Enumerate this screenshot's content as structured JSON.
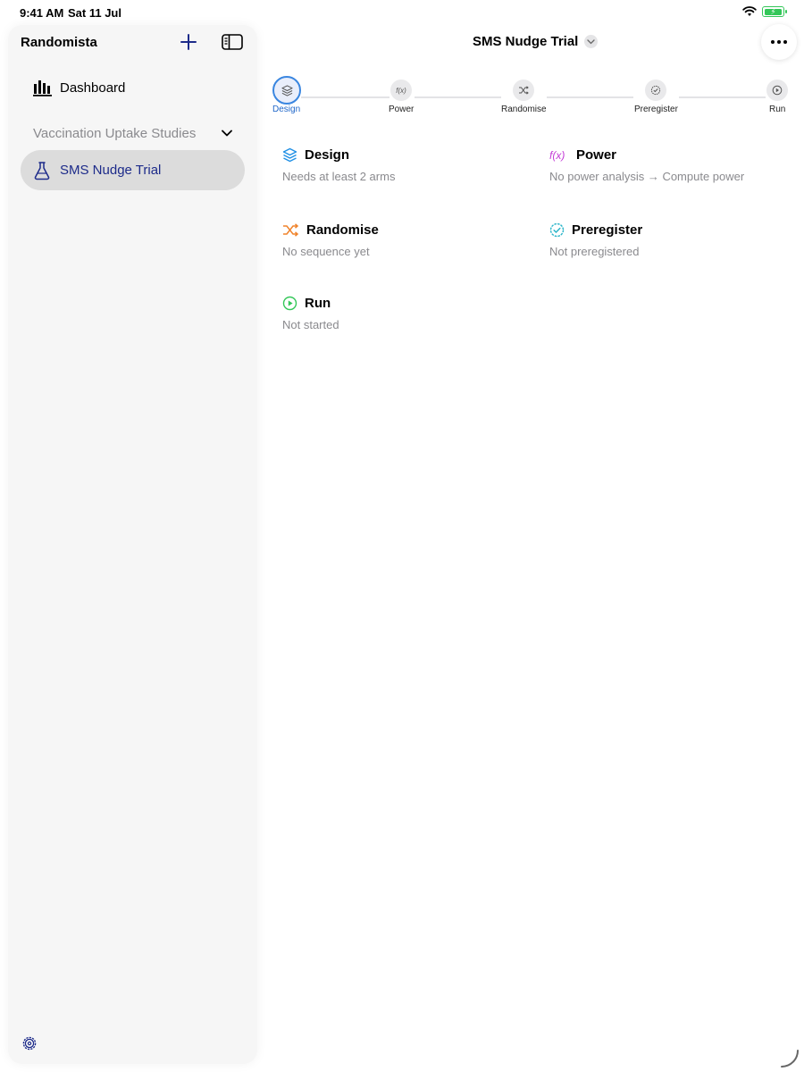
{
  "status_bar": {
    "time": "9:41 AM",
    "date": "Sat 11 Jul",
    "battery_color": "#34c759"
  },
  "sidebar": {
    "title": "Randomista",
    "add_icon": "plus-icon",
    "toggle_icon": "sidebar-toggle-icon",
    "dashboard_label": "Dashboard",
    "section_label": "Vaccination Uptake Studies",
    "active_item_label": "SMS Nudge Trial",
    "settings_icon": "gear-icon",
    "accent": "#1d2b8a"
  },
  "header": {
    "title": "SMS Nudge Trial",
    "more_icon": "ellipsis-icon"
  },
  "steps": [
    {
      "label": "Design",
      "icon": "stack-icon",
      "active": true
    },
    {
      "label": "Power",
      "icon": "function-icon",
      "active": false
    },
    {
      "label": "Randomise",
      "icon": "shuffle-icon",
      "active": false
    },
    {
      "label": "Preregister",
      "icon": "seal-check-icon",
      "active": false
    },
    {
      "label": "Run",
      "icon": "play-circle-icon",
      "active": false
    }
  ],
  "cards": {
    "design": {
      "title": "Design",
      "subtitle": "Needs at least 2 arms",
      "icon": "stack-icon",
      "color": "#1f8fe5"
    },
    "power": {
      "title": "Power",
      "subtitle": "No power analysis → Compute power",
      "icon": "function-icon",
      "color": "#c33bd6"
    },
    "randomise": {
      "title": "Randomise",
      "subtitle": "No sequence yet",
      "icon": "shuffle-icon",
      "color": "#f0832b"
    },
    "preregister": {
      "title": "Preregister",
      "subtitle": "Not preregistered",
      "icon": "seal-check-icon",
      "color": "#2bb5c9"
    },
    "run": {
      "title": "Run",
      "subtitle": "Not started",
      "icon": "play-circle-icon",
      "color": "#34c759"
    }
  }
}
